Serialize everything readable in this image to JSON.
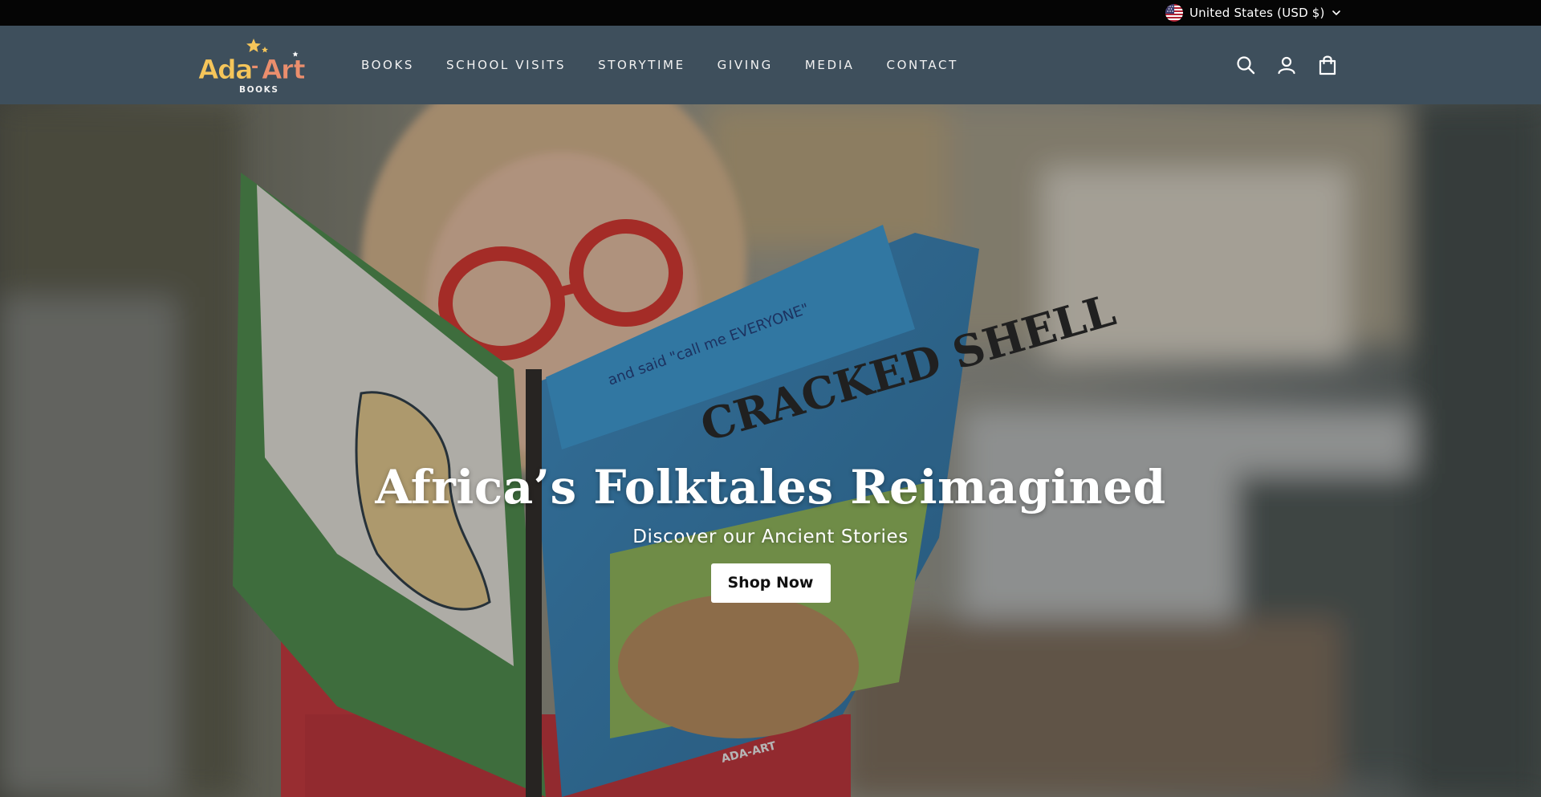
{
  "topbar": {
    "currency_label": "United States (USD $)",
    "flag_icon": "us-flag-icon",
    "chevron_icon": "chevron-down-icon"
  },
  "header": {
    "logo": {
      "name": "Ada-Art",
      "subtitle": "BOOKS"
    },
    "nav": [
      {
        "label": "BOOKS"
      },
      {
        "label": "SCHOOL VISITS"
      },
      {
        "label": "STORYTIME"
      },
      {
        "label": "GIVING"
      },
      {
        "label": "MEDIA"
      },
      {
        "label": "CONTACT"
      }
    ],
    "icons": [
      "search-icon",
      "account-icon",
      "cart-icon"
    ]
  },
  "hero": {
    "title": "Africa’s Folktales Reimagined",
    "subtitle": "Discover our Ancient Stories",
    "cta_label": "Shop Now",
    "book_cover_text": "CRACKED SHELL",
    "book_banner_text": "and said \"call me EVERYONE\"",
    "book_spine_text": "ADA-ART"
  },
  "colors": {
    "topbar_bg": "#050505",
    "header_bg": "#3e4f5c",
    "nav_text": "#f2f2f2",
    "logo_yellow": "#f5c55a",
    "logo_pink": "#eb8e6d",
    "cta_bg": "#ffffff",
    "cta_text": "#111111"
  }
}
